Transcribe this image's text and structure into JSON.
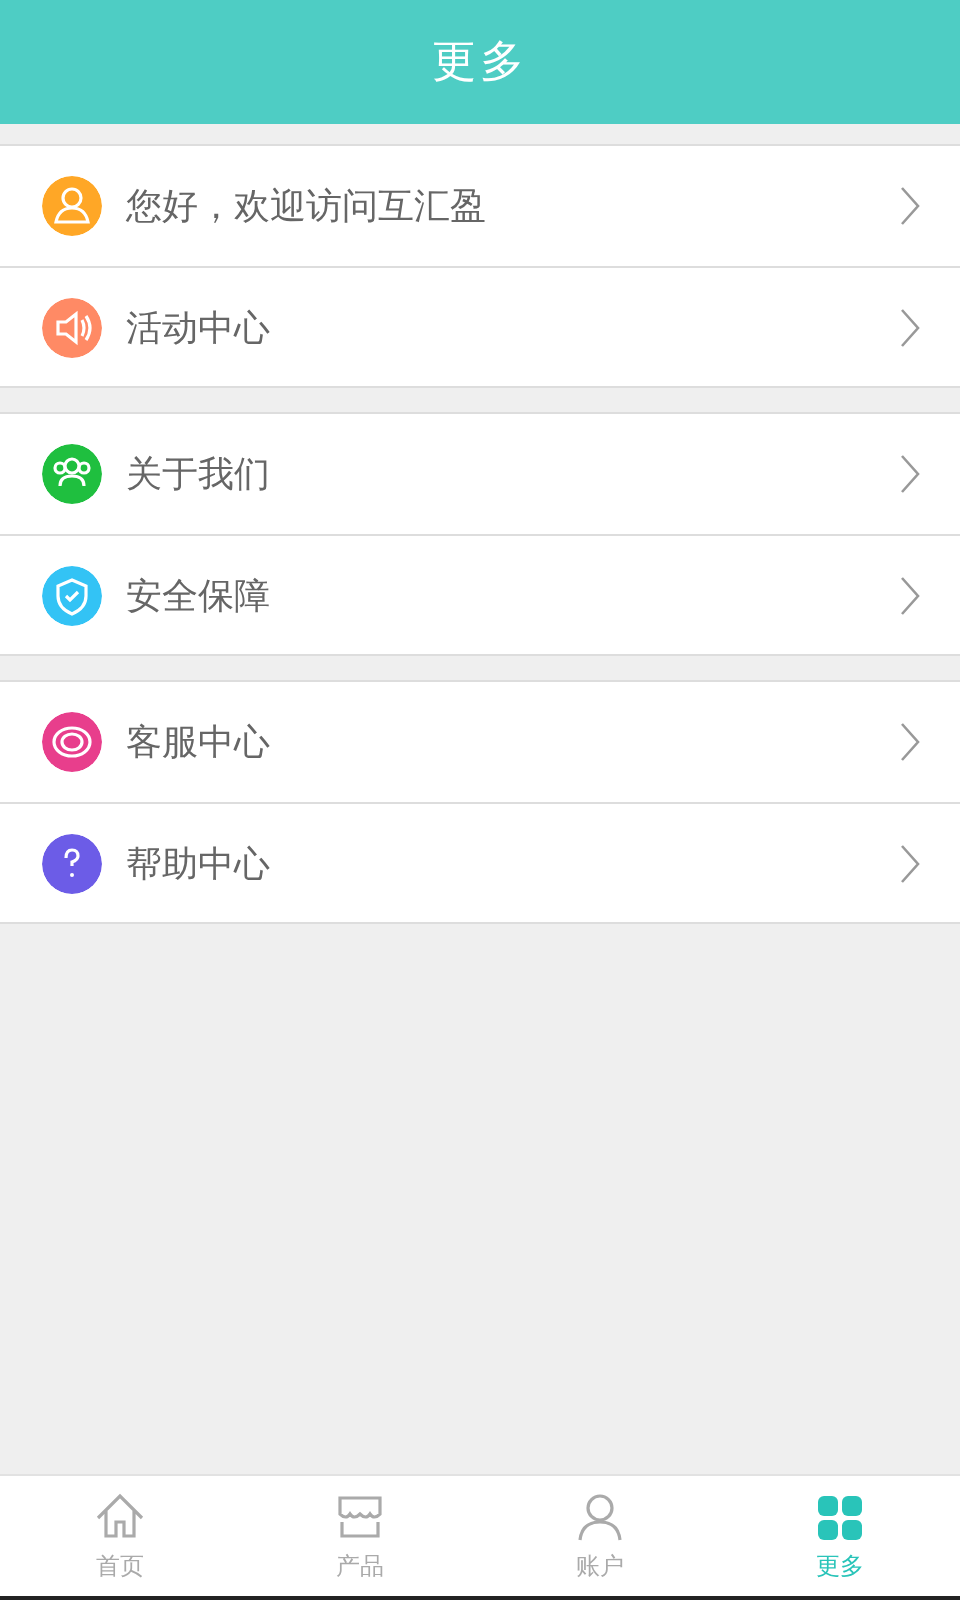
{
  "header": {
    "title": "更多"
  },
  "groups": [
    {
      "items": [
        {
          "label": "您好，欢迎访问互汇盈",
          "kind": "user",
          "color": "#ffa726"
        },
        {
          "label": "活动中心",
          "kind": "speaker",
          "color": "#ff8a65"
        }
      ]
    },
    {
      "items": [
        {
          "label": "关于我们",
          "kind": "people",
          "color": "#1fbf3f"
        },
        {
          "label": "安全保障",
          "kind": "shield",
          "color": "#33c3f5"
        }
      ]
    },
    {
      "items": [
        {
          "label": "客服中心",
          "kind": "headset",
          "color": "#e83e8c"
        },
        {
          "label": "帮助中心",
          "kind": "help",
          "color": "#6c5ce7"
        }
      ]
    }
  ],
  "tabs": [
    {
      "label": "首页",
      "kind": "home",
      "selected": false
    },
    {
      "label": "产品",
      "kind": "shop",
      "selected": false
    },
    {
      "label": "账户",
      "kind": "user",
      "selected": false
    },
    {
      "label": "更多",
      "kind": "grid",
      "selected": true
    }
  ]
}
